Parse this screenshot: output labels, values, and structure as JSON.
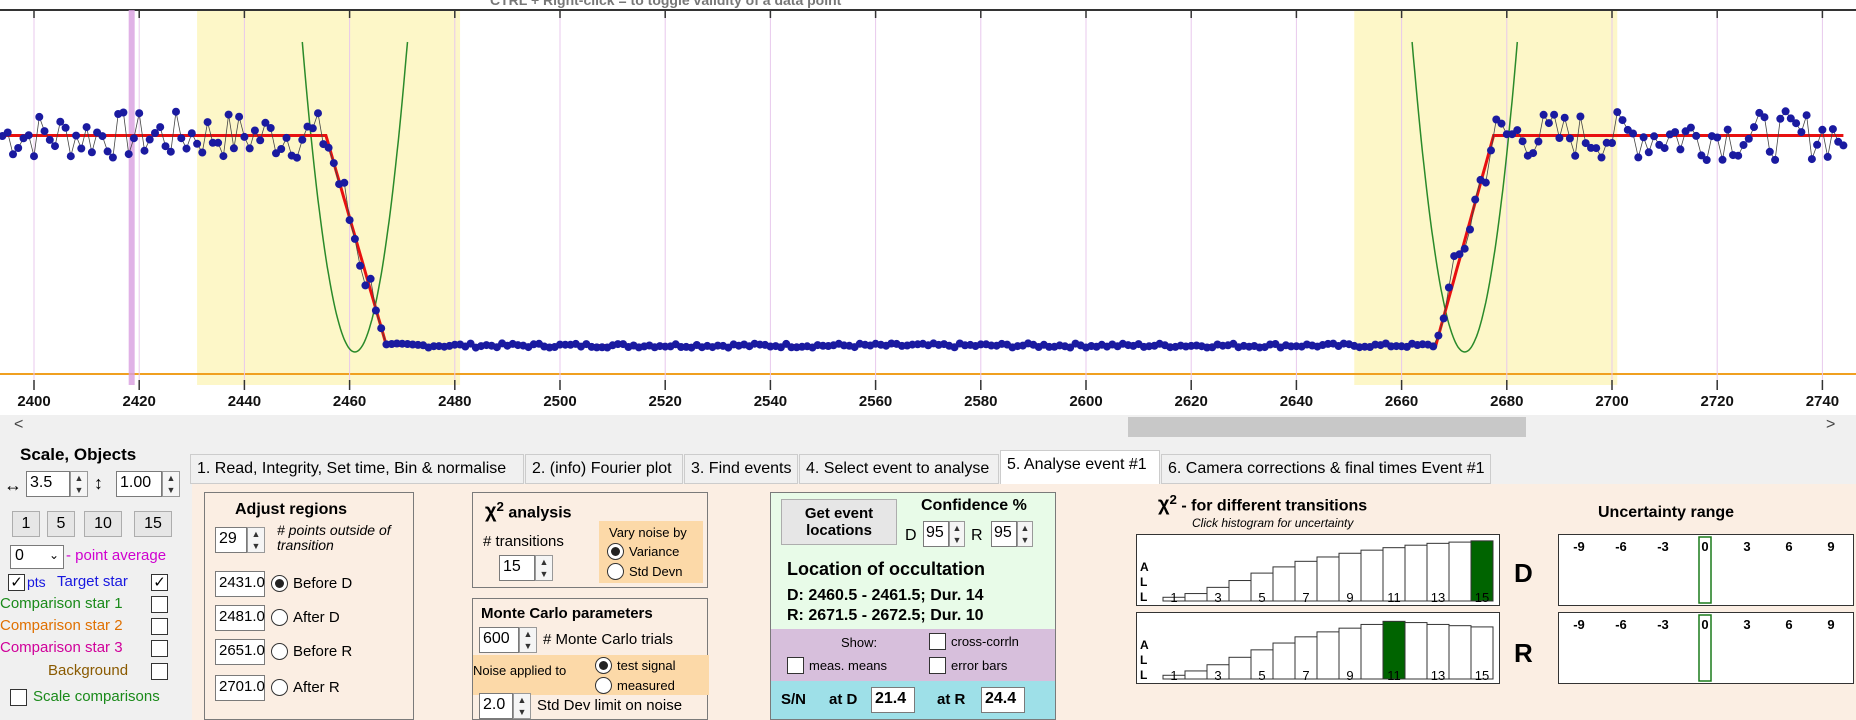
{
  "top_hint": "CTRL + Right-click  =  to toggle validity of a data point",
  "chart_data": {
    "type": "line",
    "x_ticks": [
      "2400",
      "2420",
      "2440",
      "2460",
      "2480",
      "2500",
      "2520",
      "2540",
      "2560",
      "2580",
      "2600",
      "2620",
      "2640",
      "2660",
      "2680",
      "2700",
      "2720",
      "2740"
    ],
    "xlim": [
      2394,
      2744
    ],
    "ylim": [
      0,
      1
    ],
    "model": {
      "baseline": 0.67,
      "bottom": 0.07,
      "d_start": 2455.5,
      "d_end": 2467,
      "r_start": 2666.5,
      "r_end": 2677.5
    },
    "shaded_regions": [
      [
        2431,
        2481
      ],
      [
        2651,
        2701
      ]
    ],
    "grid": true
  },
  "scroll": {
    "left_arrow": "<",
    "right_arrow": ">"
  },
  "left_panel": {
    "title": "Scale,  Objects",
    "h_scale_icon": "↔",
    "h_scale": "3.5",
    "v_scale_icon": "↕",
    "v_scale": "1.00",
    "bin_buttons": [
      "1",
      "5",
      "10",
      "15"
    ],
    "point_avg_value": "0",
    "point_avg_label": "- point average",
    "pts_label": "pts",
    "target_label": "Target star",
    "comp1": "Comparison star 1",
    "comp2": "Comparison star 2",
    "comp3": "Comparison star 3",
    "background": "Background",
    "scale_comparisons": "Scale comparisons",
    "check_mark": "✓"
  },
  "tabs": [
    "1.  Read, Integrity, Set time, Bin & normalise",
    "2. (info)  Fourier plot",
    "3. Find events",
    "4. Select event to analyse",
    "5. Analyse event #1",
    "6. Camera corrections & final times Event #1"
  ],
  "adjust": {
    "title": "Adjust regions",
    "points_value": "29",
    "points_note": "# points outside of transition",
    "before_d_val": "2431.0",
    "before_d": "Before D",
    "after_d_val": "2481.0",
    "after_d": "After D",
    "before_r_val": "2651.0",
    "before_r": "Before R",
    "after_r_val": "2701.0",
    "after_r": "After R"
  },
  "chi": {
    "title_sym": "χ",
    "title_sup": "2",
    "title_rest": " analysis",
    "transitions_label": "# transitions",
    "transitions_value": "15",
    "vary_noise": "Vary noise by",
    "variance": "Variance",
    "std_devn": "Std Devn"
  },
  "monte": {
    "title": "Monte Carlo parameters",
    "trials_value": "600",
    "trials_label": "# Monte Carlo trials",
    "noise_applied": "Noise applied to",
    "test_signal": "test signal",
    "measured": "measured",
    "std_value": "2.0",
    "std_label": "Std Dev limit on noise"
  },
  "event": {
    "get_btn_line1": "Get event",
    "get_btn_line2": "locations",
    "confidence": "Confidence %",
    "d_label": "D",
    "d_value": "95",
    "r_label": "R",
    "r_value": "95",
    "loc_title": "Location of occultation",
    "d_line": "D: 2460.5 - 2461.5; Dur. 14",
    "r_line": "R: 2671.5 - 2672.5; Dur. 10",
    "show": "Show:",
    "cross_corr": "cross-corrln",
    "meas_means": "meas. means",
    "error_bars": "error bars",
    "sn": "S/N",
    "at_d": "at D",
    "sn_d": "21.4",
    "at_r": "at R",
    "sn_r": "24.4"
  },
  "chi_hist": {
    "title_sym": "χ",
    "title_sup": "2",
    "title_rest": " - for different transitions",
    "subtitle": "Click histogram for uncertainty",
    "axis_letters": [
      "A",
      "L",
      "L"
    ],
    "labels": [
      "1",
      "3",
      "5",
      "7",
      "9",
      "11",
      "13",
      "15"
    ],
    "d_label": "D",
    "r_label": "R",
    "d_values": [
      0.06,
      0.12,
      0.22,
      0.33,
      0.45,
      0.55,
      0.64,
      0.71,
      0.77,
      0.82,
      0.86,
      0.9,
      0.93,
      0.95,
      0.97
    ],
    "d_highlight": 15,
    "r_values": [
      0.06,
      0.13,
      0.23,
      0.35,
      0.47,
      0.58,
      0.68,
      0.76,
      0.82,
      0.88,
      0.93,
      0.91,
      0.88,
      0.86,
      0.84
    ],
    "r_highlight": 11,
    "highlight_color": "#006400"
  },
  "uncertainty": {
    "title": "Uncertainty range",
    "labels": [
      "-9",
      "-6",
      "-3",
      "0",
      "3",
      "6",
      "9"
    ]
  }
}
